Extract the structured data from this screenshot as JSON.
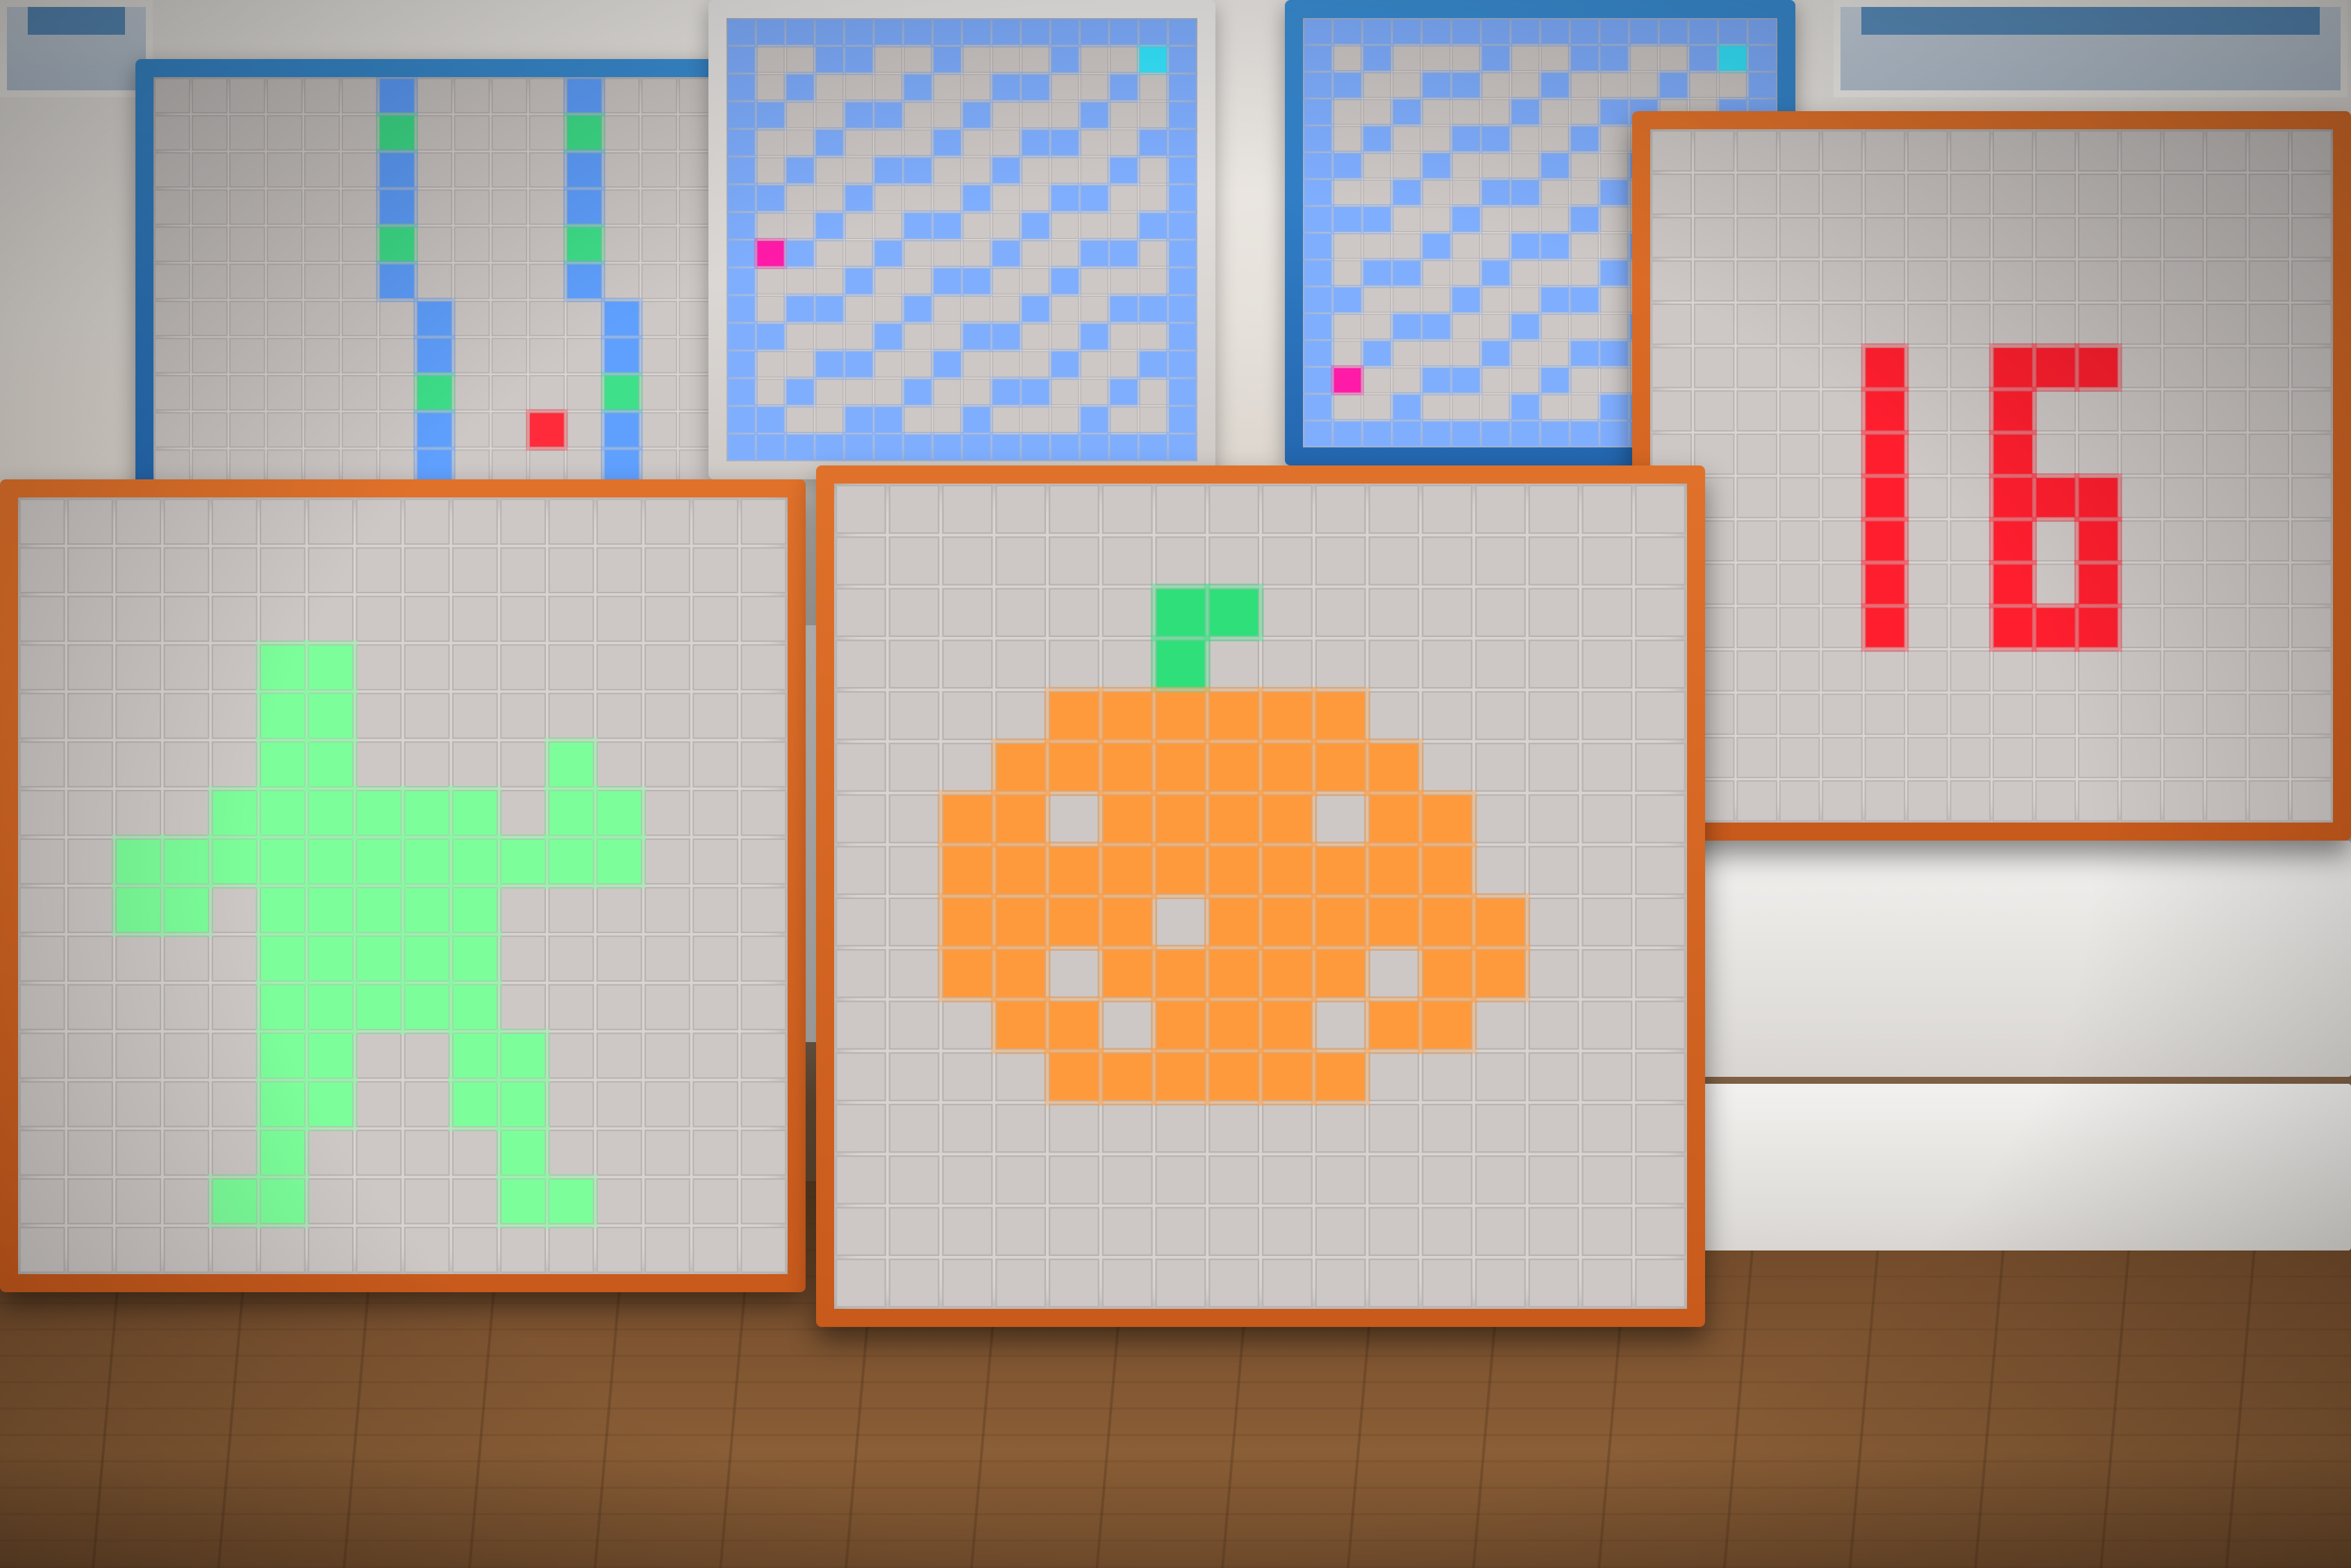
{
  "scene": {
    "description_icons": [
      "led-matrix-panel",
      "wooden-floor",
      "window"
    ]
  },
  "panels": {
    "bars": {
      "grid": 16,
      "colors": {
        "blue": "#5fa0ff",
        "green": "#3ee08a",
        "red": "#ff2a3a"
      }
    },
    "maze1": {
      "grid": 16,
      "colors": {
        "wall": "#7faeff",
        "goal": "#35e6ff",
        "player": "#ff1aa8"
      }
    },
    "maze2": {
      "grid": 16,
      "colors": {
        "wall": "#7faeff",
        "goal": "#35e6ff",
        "player": "#ff1aa8"
      }
    },
    "score": {
      "grid": 16,
      "text": "16",
      "color": "#ff1e2e"
    },
    "figure": {
      "grid": 16,
      "color": "#7cff9a"
    },
    "pumpkin": {
      "grid": 16,
      "color": "#ff9a3c",
      "stem": "#2fe07a"
    }
  }
}
